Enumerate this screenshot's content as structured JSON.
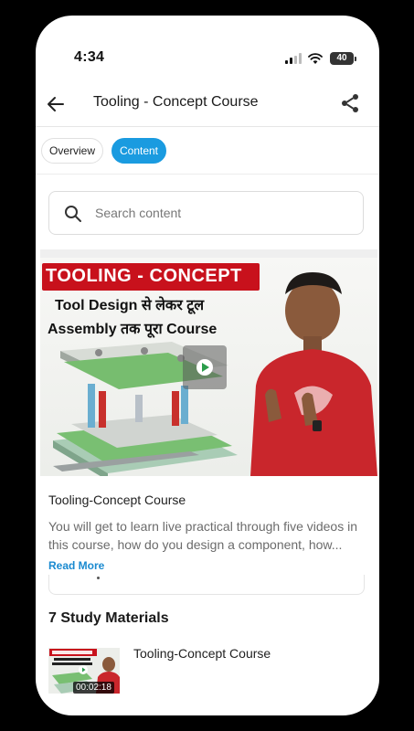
{
  "status_bar": {
    "time": "4:34",
    "battery": "40"
  },
  "header": {
    "title": "Tooling - Concept Course"
  },
  "tabs": [
    {
      "label": "Overview",
      "active": false
    },
    {
      "label": "Content",
      "active": true
    }
  ],
  "search": {
    "placeholder": "Search content"
  },
  "thumbnail": {
    "banner": "TOOLING - CONCEPT",
    "line1": "Tool Design से लेकर टूल",
    "line2": "Assembly तक पूरा Course"
  },
  "course": {
    "title": "Tooling-Concept Course",
    "description": "You will get to learn live practical through five videos in this course, how do you design a component, how...",
    "read_more": "Read More"
  },
  "study_materials": {
    "heading": "7 Study Materials",
    "items": [
      {
        "title": "Tooling-Concept Course",
        "duration": "00:02:18"
      }
    ]
  },
  "colors": {
    "accent": "#1a9be0",
    "link": "#1a8ad0",
    "banner_red": "#c8111c"
  }
}
